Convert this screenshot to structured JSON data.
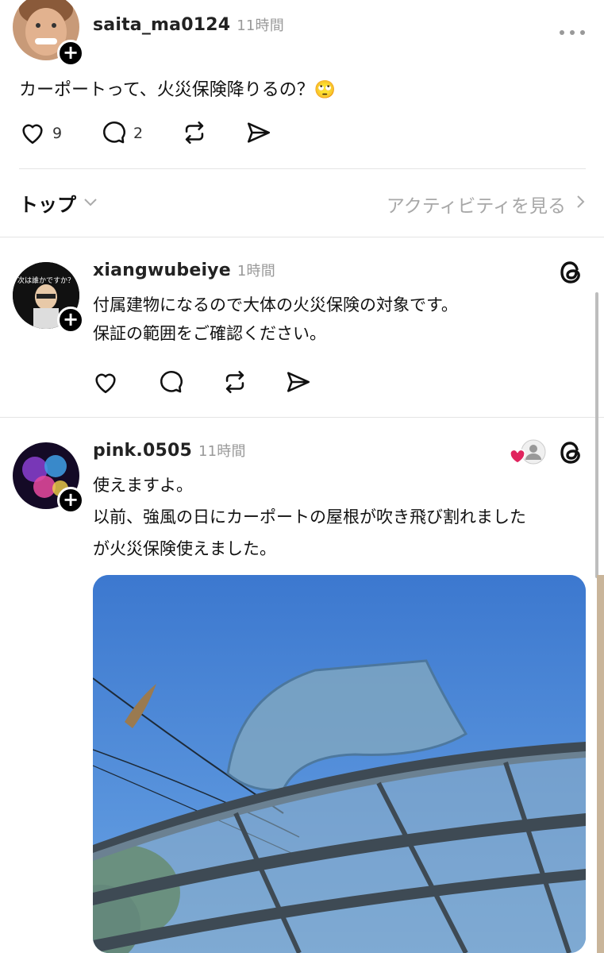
{
  "post": {
    "username": "saita_ma0124",
    "time": "11時間",
    "text": "カーポートって、火災保険降りるの？🙄",
    "like_count": "9",
    "reply_count": "2"
  },
  "sort_bar": {
    "label": "トップ",
    "activity_link": "アクティビティを見る"
  },
  "replies": [
    {
      "username": "xiangwubeiye",
      "time": "1時間",
      "avatar_text": "次は誰かですか？",
      "lines": [
        "付属建物になるので大体の火災保険の対象です。",
        "保証の範囲をご確認ください。"
      ]
    },
    {
      "username": "pink.0505",
      "time": "11時間",
      "lines": [
        "使えますよ。",
        "以前、強風の日にカーポートの屋根が吹き飛び割れました",
        "が火災保険使えました。"
      ]
    }
  ],
  "colors": {
    "sky": "#4a86d6",
    "like_heart": "#e0245e"
  }
}
